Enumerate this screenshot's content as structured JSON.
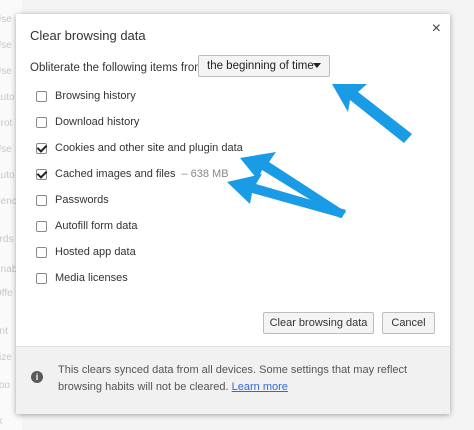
{
  "dialog": {
    "title": "Clear browsing data",
    "obliterate_label": "Obliterate the following items from:",
    "time_range": "the beginning of time",
    "options": [
      {
        "label": "Browsing history",
        "checked": false
      },
      {
        "label": "Download history",
        "checked": false
      },
      {
        "label": "Cookies and other site and plugin data",
        "checked": true
      },
      {
        "label": "Cached images and files",
        "checked": true,
        "size": "– 638 MB"
      },
      {
        "label": "Passwords",
        "checked": false
      },
      {
        "label": "Autofill form data",
        "checked": false
      },
      {
        "label": "Hosted app data",
        "checked": false
      },
      {
        "label": "Media licenses",
        "checked": false
      }
    ],
    "clear_button": "Clear browsing data",
    "cancel_button": "Cancel",
    "footer_text": "This clears synced data from all devices. Some settings that may reflect browsing habits will not be cleared.",
    "learn_more": "Learn more",
    "close_glyph": "×"
  },
  "background_fragments": [
    "Use",
    "Use",
    "Use",
    "Auto",
    "Prot",
    "Use",
    "Auto",
    "Senc",
    "ords",
    "Enab",
    "Offe",
    "ont",
    "size",
    "zoo",
    "rk"
  ],
  "colors": {
    "arrow": "#1a9be6",
    "link": "#3367d6"
  }
}
